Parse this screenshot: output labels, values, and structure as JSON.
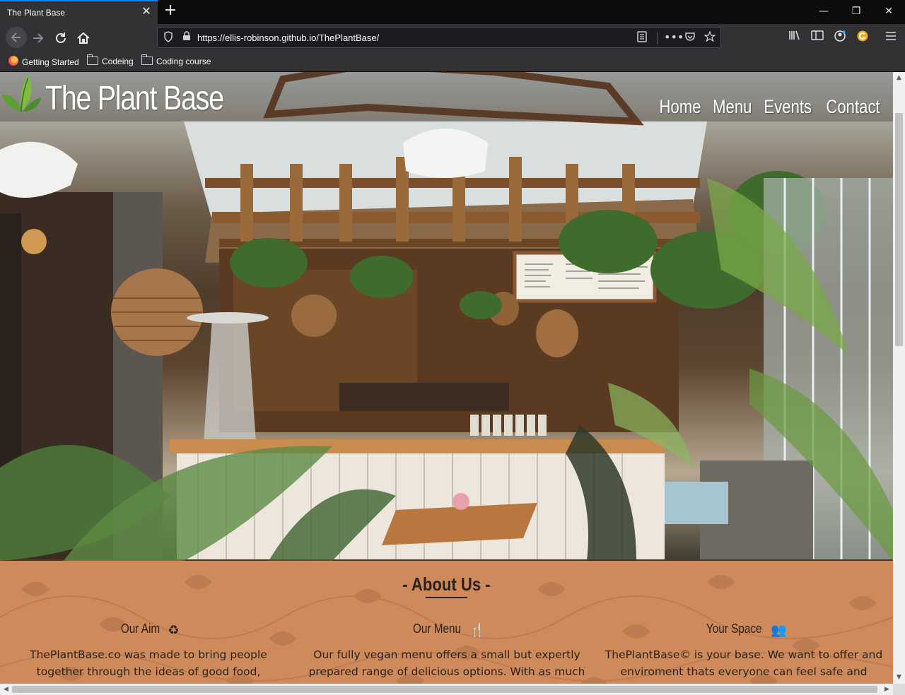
{
  "browser": {
    "tab_title": "The Plant Base",
    "tab_close": "✕",
    "new_tab": "+",
    "url": "https://ellis-robinson.github.io/ThePlantBase/",
    "window_controls": {
      "minimize": "—",
      "restore": "❐",
      "close": "✕"
    },
    "bookmarks": [
      "Getting Started",
      "Codeing",
      "Coding course"
    ]
  },
  "site": {
    "title": "The Plant Base",
    "nav": [
      "Home",
      "Menu",
      "Events",
      "Contact"
    ]
  },
  "about": {
    "heading": "- About Us -",
    "columns": [
      {
        "title": "Our Aim",
        "icon": "recycle-icon",
        "glyph": "♻",
        "text": "ThePlantBase.co was made to bring people together through the ideas of good food, community and"
      },
      {
        "title": "Our Menu",
        "icon": "utensils-icon",
        "glyph": "🍴",
        "text": "Our fully vegan menu offers a small but expertly prepared range of delicious options. With as much as"
      },
      {
        "title": "Your Space",
        "icon": "users-icon",
        "glyph": "👥",
        "text": "ThePlantBase© is your base. We want to offer and enviroment thats everyone can feel safe and"
      }
    ]
  },
  "colors": {
    "about_bg": "#cf8a5c",
    "tab_accent": "#0a84ff",
    "leaf_green": "#6aa83a"
  }
}
